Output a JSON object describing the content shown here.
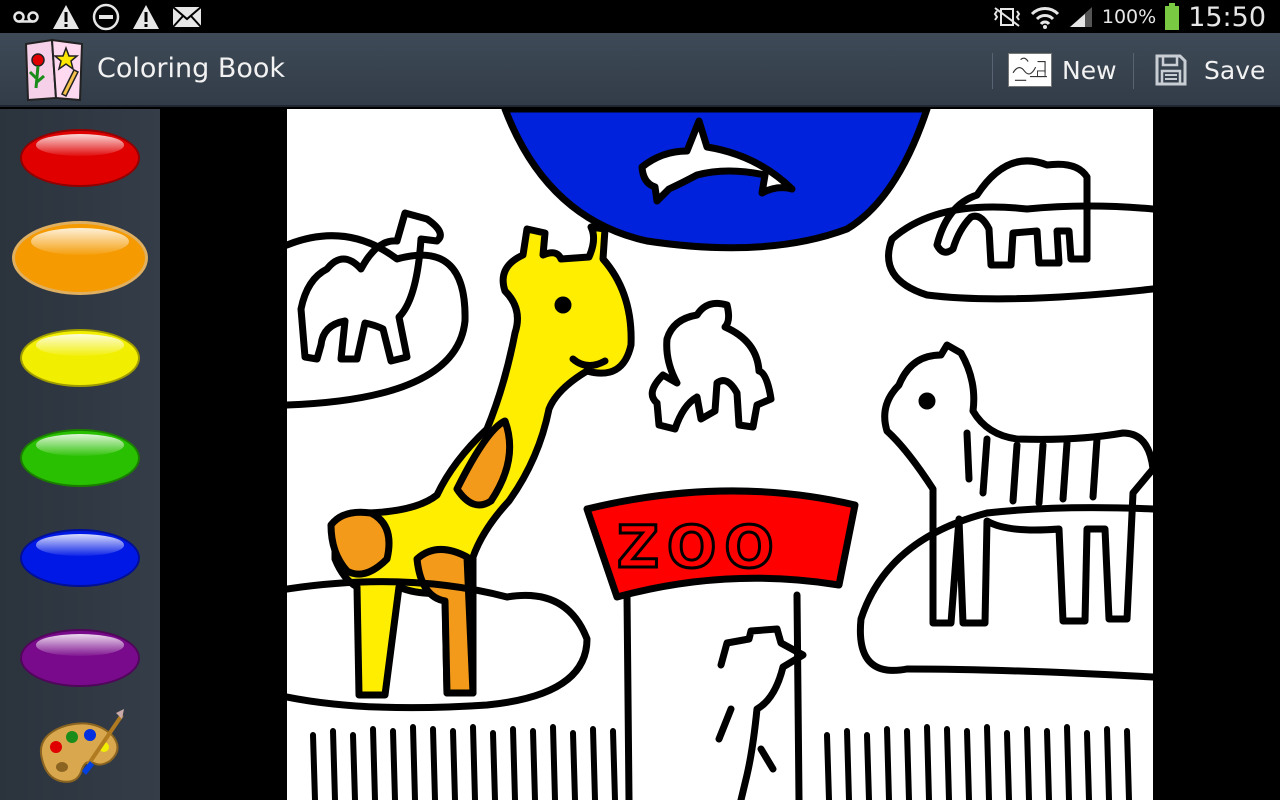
{
  "status_bar": {
    "left_icons": [
      "voicemail-icon",
      "warning-icon",
      "do-not-disturb-icon",
      "warning-icon",
      "email-icon"
    ],
    "right_icons": [
      "vibrate-mute-icon",
      "wifi-icon",
      "signal-icon"
    ],
    "battery_percent": "100%",
    "time": "15:50"
  },
  "action_bar": {
    "title": "Coloring Book",
    "new_label": "New",
    "save_label": "Save"
  },
  "palette": {
    "colors": [
      "#e00000",
      "#f59a00",
      "#f2ee00",
      "#28c000",
      "#0018e6",
      "#7a0a8c"
    ],
    "tool_icon": "painter-palette-icon"
  },
  "drawing": {
    "sign_text": "ZOO",
    "colors": {
      "water": "#0022dd",
      "giraffe_body": "#ffee00",
      "giraffe_spots": "#f39a1a",
      "sign": "#ff0000"
    }
  }
}
